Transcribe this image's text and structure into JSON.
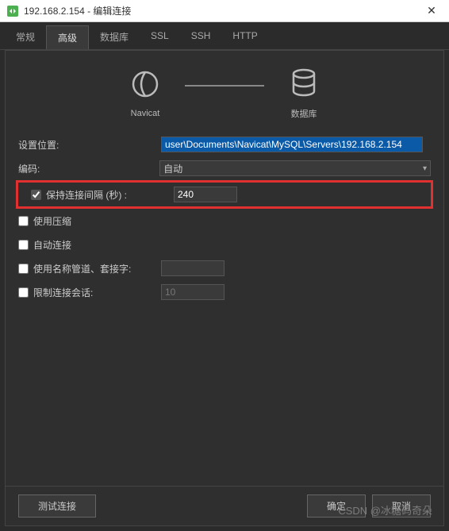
{
  "window": {
    "title": "192.168.2.154 - 编辑连接",
    "close": "✕"
  },
  "tabs": {
    "general": "常规",
    "advanced": "高级",
    "database": "数据库",
    "ssl": "SSL",
    "ssh": "SSH",
    "http": "HTTP"
  },
  "diagram": {
    "left_label": "Navicat",
    "right_label": "数据库"
  },
  "form": {
    "location_label": "设置位置:",
    "location_value": "user\\Documents\\Navicat\\MySQL\\Servers\\192.168.2.154",
    "encoding_label": "编码:",
    "encoding_value": "自动",
    "keepalive_label": "保持连接间隔 (秒) :",
    "keepalive_value": "240",
    "compression_label": "使用压缩",
    "autoconnect_label": "自动连接",
    "namedpipe_label": "使用名称管道、套接字:",
    "namedpipe_value": "",
    "limit_label": "限制连接会话:",
    "limit_value": "10"
  },
  "footer": {
    "test": "测试连接",
    "ok": "确定",
    "cancel": "取消"
  },
  "watermark": "CSDN @冰糖码奇朵"
}
